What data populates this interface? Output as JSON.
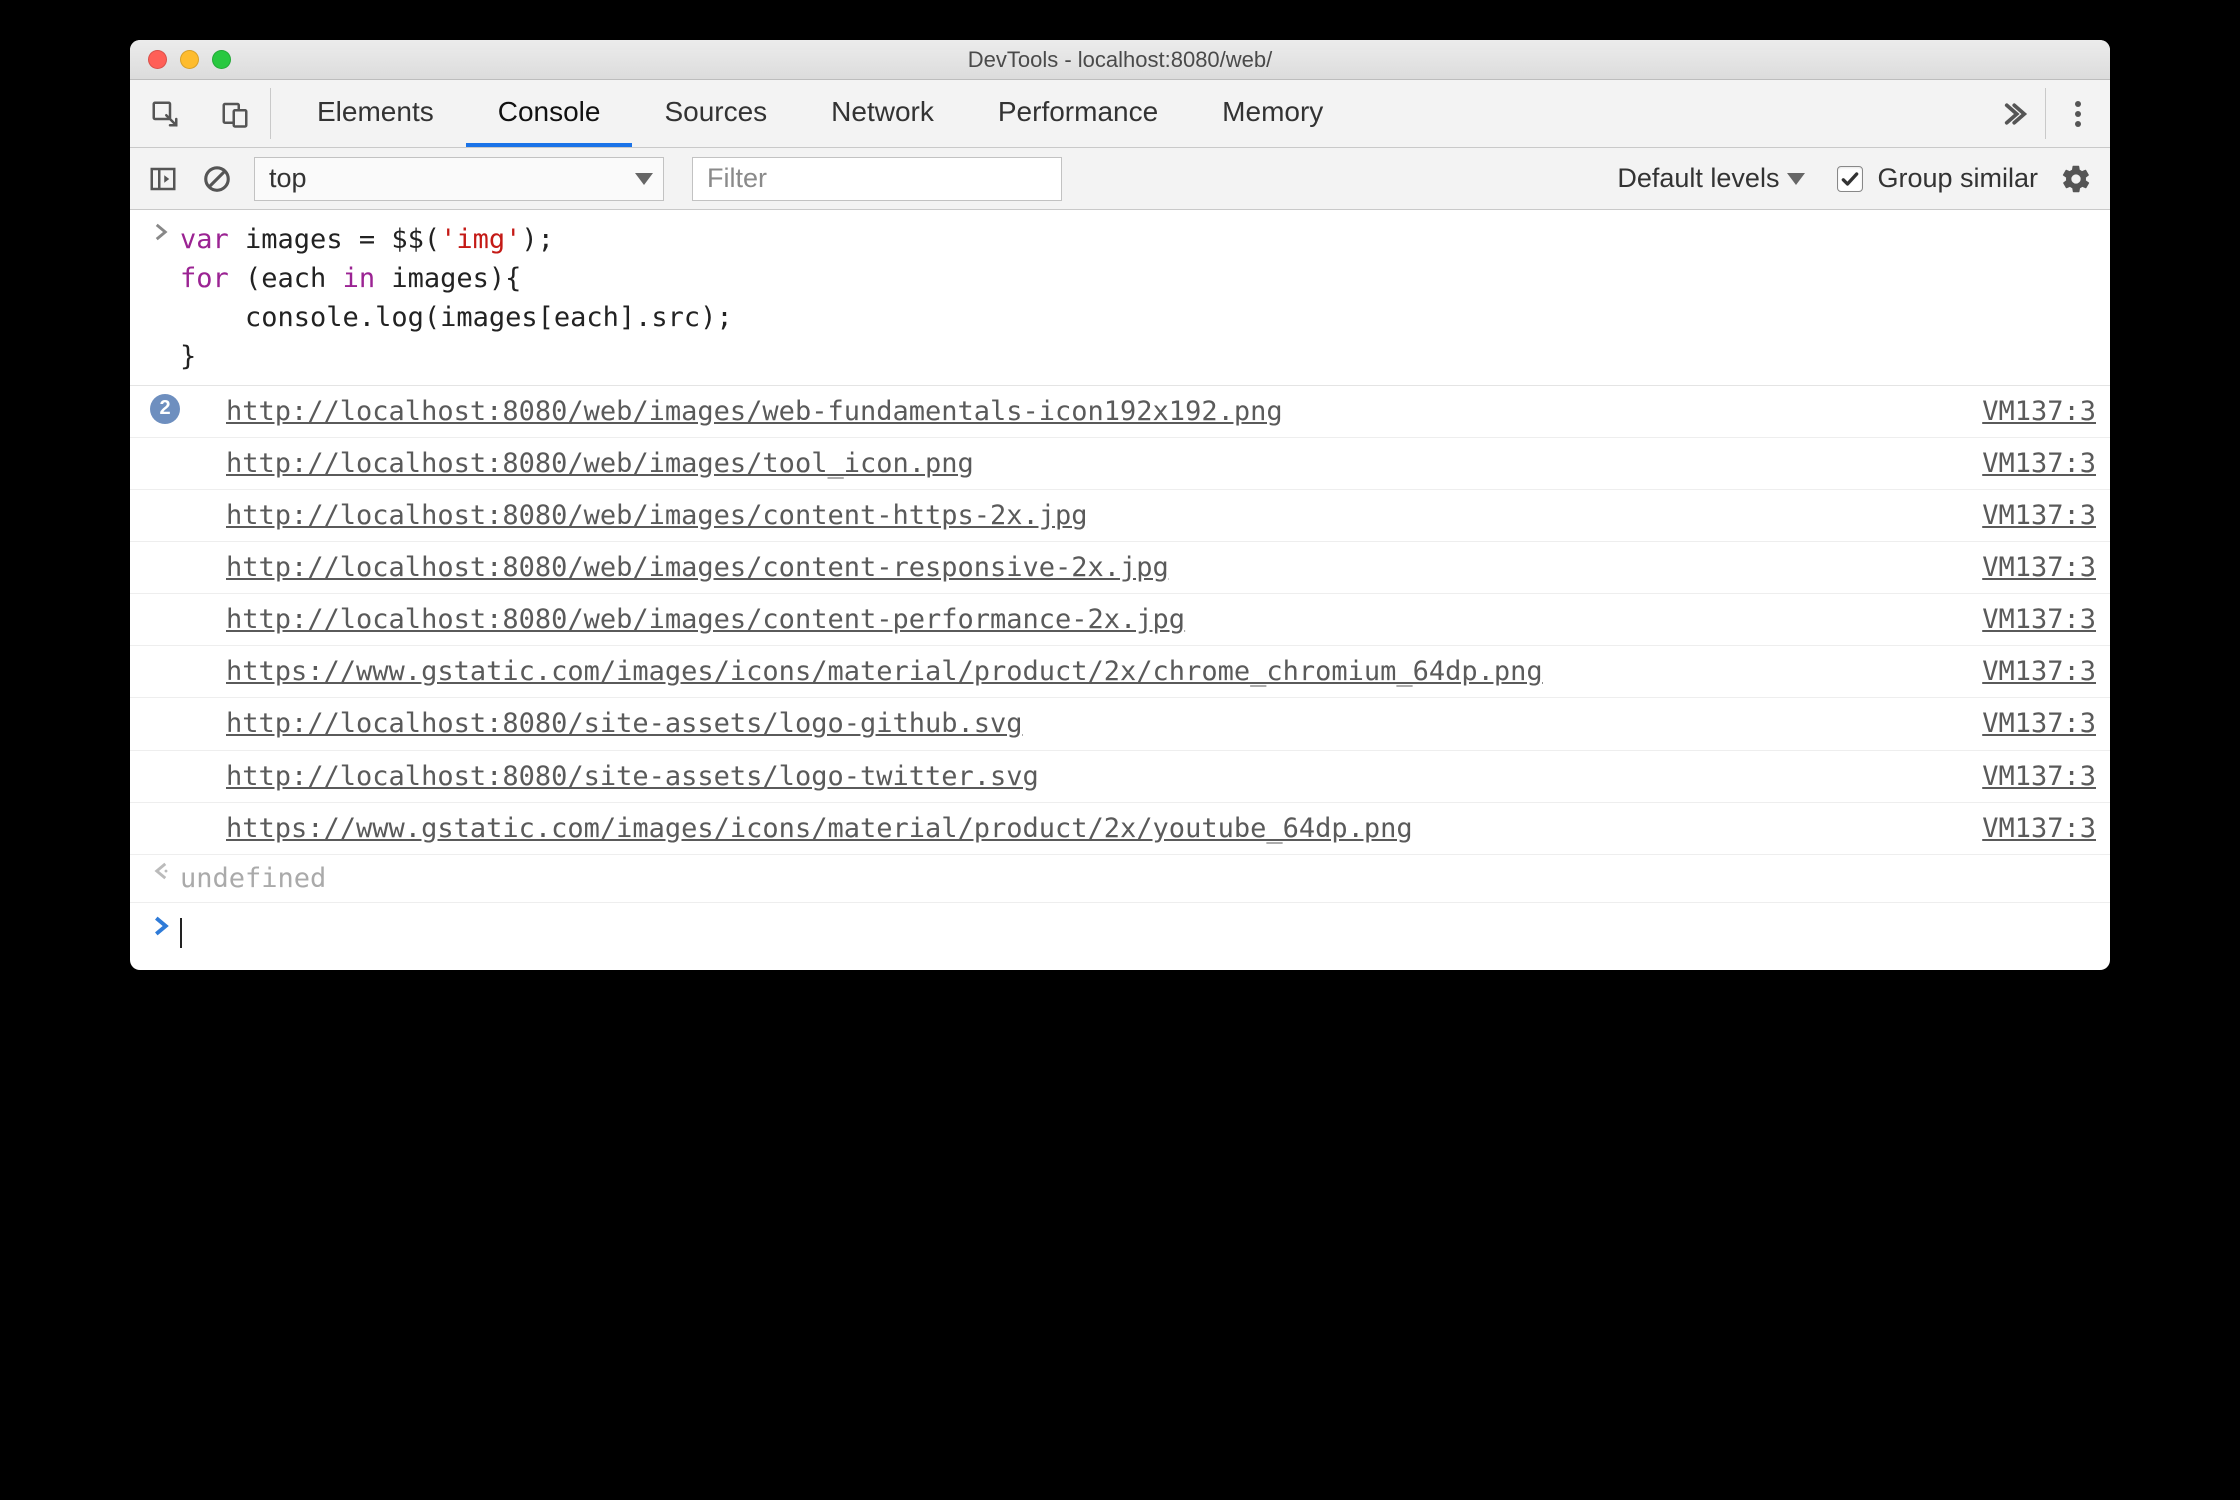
{
  "window": {
    "title": "DevTools - localhost:8080/web/"
  },
  "tabs": [
    "Elements",
    "Console",
    "Sources",
    "Network",
    "Performance",
    "Memory"
  ],
  "active_tab": "Console",
  "toolbar": {
    "context": "top",
    "filter_placeholder": "Filter",
    "levels_label": "Default levels",
    "group_label": "Group similar",
    "group_checked": true
  },
  "code_input": {
    "line1_pre": "var",
    "line1_mid": " images = $$(",
    "line1_str": "'img'",
    "line1_post": ");",
    "line2_pre": "for",
    "line2_mid": " (each ",
    "line2_kw2": "in",
    "line2_post": " images){",
    "line3": "    console.log(images[each].src);",
    "line4": "}"
  },
  "logs": [
    {
      "badge": "2",
      "url": "http://localhost:8080/web/images/web-fundamentals-icon192x192.png",
      "src": "VM137:3"
    },
    {
      "url": "http://localhost:8080/web/images/tool_icon.png",
      "src": "VM137:3"
    },
    {
      "url": "http://localhost:8080/web/images/content-https-2x.jpg",
      "src": "VM137:3"
    },
    {
      "url": "http://localhost:8080/web/images/content-responsive-2x.jpg",
      "src": "VM137:3"
    },
    {
      "url": "http://localhost:8080/web/images/content-performance-2x.jpg",
      "src": "VM137:3"
    },
    {
      "url": "https://www.gstatic.com/images/icons/material/product/2x/chrome_chromium_64dp.png",
      "src": "VM137:3"
    },
    {
      "url": "http://localhost:8080/site-assets/logo-github.svg",
      "src": "VM137:3"
    },
    {
      "url": "http://localhost:8080/site-assets/logo-twitter.svg",
      "src": "VM137:3"
    },
    {
      "url": "https://www.gstatic.com/images/icons/material/product/2x/youtube_64dp.png",
      "src": "VM137:3"
    }
  ],
  "result": "undefined"
}
